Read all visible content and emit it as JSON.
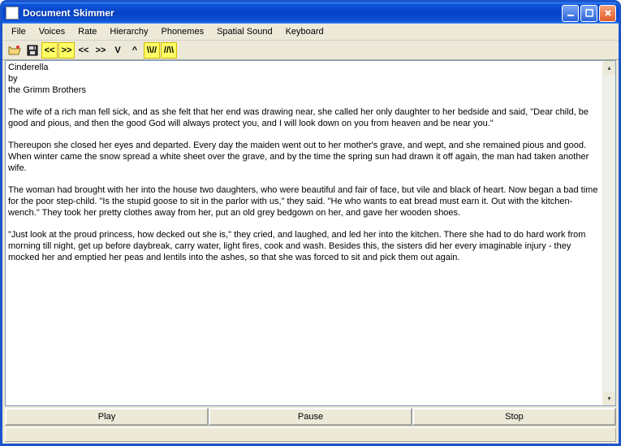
{
  "window": {
    "title": "Document Skimmer"
  },
  "menu": {
    "file": "File",
    "voices": "Voices",
    "rate": "Rate",
    "hierarchy": "Hierarchy",
    "phonemes": "Phonemes",
    "spatial": "Spatial Sound",
    "keyboard": "Keyboard"
  },
  "toolbar": {
    "prev_fast": "<<",
    "next_fast": ">>",
    "prev": "<<",
    "next": ">>",
    "down": "V",
    "up": "^",
    "mark1": "\\\\//",
    "mark2": "//\\\\"
  },
  "document": {
    "text": "Cinderella\nby\nthe Grimm Brothers\n\nThe wife of a rich man fell sick, and as she felt that her end was drawing near, she called her only daughter to her bedside and said, \"Dear child, be good and pious, and then the good God will always protect you, and I will look down on you from heaven and be near you.\"\n\nThereupon she closed her eyes and departed. Every day the maiden went out to her mother's grave, and wept, and she remained pious and good. When winter came the snow spread a white sheet over the grave, and by the time the spring sun had drawn it off again, the man had taken another wife.\n\nThe woman had brought with her into the house two daughters, who were beautiful and fair of face, but vile and black of heart. Now began a bad time for the poor step-child. \"Is the stupid goose to sit in the parlor with us,\" they said. \"He who wants to eat bread must earn it. Out with the kitchen-wench.\" They took her pretty clothes away from her, put an old grey bedgown on her, and gave her wooden shoes.\n\n\"Just look at the proud princess, how decked out she is,\" they cried, and laughed, and led her into the kitchen. There she had to do hard work from morning till night, get up before daybreak, carry water, light fires, cook and wash. Besides this, the sisters did her every imaginable injury - they mocked her and emptied her peas and lentils into the ashes, so that she was forced to sit and pick them out again."
  },
  "buttons": {
    "play": "Play",
    "pause": "Pause",
    "stop": "Stop"
  }
}
